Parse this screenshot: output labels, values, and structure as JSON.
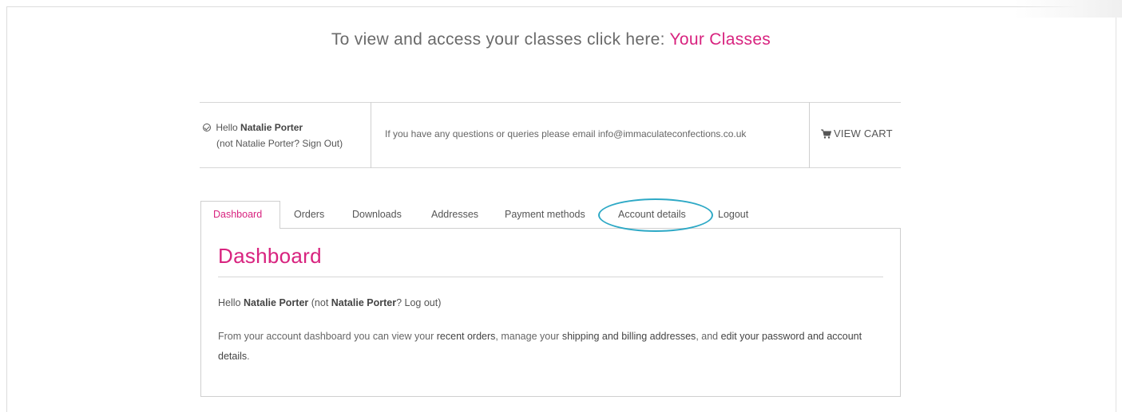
{
  "top": {
    "prompt_text": "To view and access your classes click here:",
    "classes_link": "Your Classes"
  },
  "info_bar": {
    "hello": "Hello",
    "name": "Natalie Porter",
    "not_user": "(not Natalie Porter? Sign Out)",
    "questions": "If you have any questions or queries please email info@immaculateconfections.co.uk",
    "view_cart": "VIEW CART"
  },
  "tabs": [
    {
      "label": "Dashboard"
    },
    {
      "label": "Orders"
    },
    {
      "label": "Downloads"
    },
    {
      "label": "Addresses"
    },
    {
      "label": "Payment methods"
    },
    {
      "label": "Account details"
    },
    {
      "label": "Logout"
    }
  ],
  "panel": {
    "title": "Dashboard",
    "greet_hello": "Hello",
    "greet_name": "Natalie Porter",
    "greet_not": "(not",
    "greet_name2": "Natalie Porter",
    "greet_q": "?",
    "greet_logout": "Log out",
    "greet_end": ")",
    "desc_1": "From your account dashboard you can view your",
    "desc_link1": "recent orders",
    "desc_2": ", manage your",
    "desc_link2": "shipping and billing addresses",
    "desc_3": ", and",
    "desc_link3": "edit your password and account details",
    "desc_4": "."
  },
  "colors": {
    "accent": "#d8237f",
    "highlight_ring": "#2ea9c6",
    "border": "#cfcfcf"
  },
  "icons": [
    "check-circle-icon",
    "cart-icon"
  ]
}
